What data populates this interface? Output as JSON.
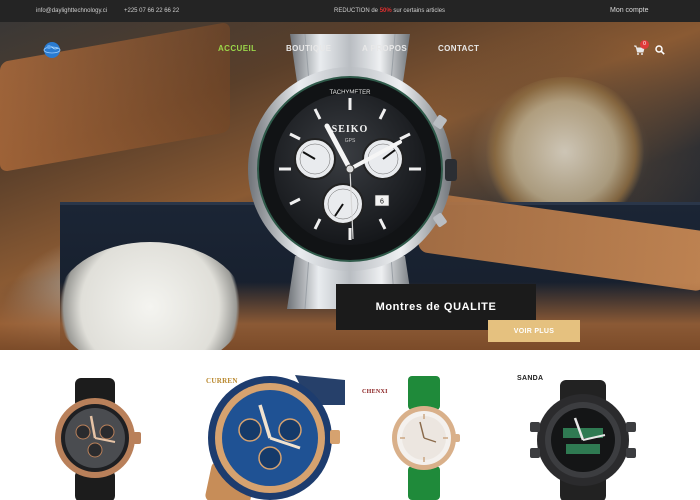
{
  "topbar": {
    "email": "info@daylighttechnology.ci",
    "phone": "+225 07 66 22 66 22",
    "promo_prefix": "REDUCTION de ",
    "promo_percent": "50%",
    "promo_suffix": " sur certains articles",
    "account_label": "Mon compte"
  },
  "nav": {
    "items": [
      "ACCUEIL",
      "BOUTIQUE",
      "A PROPOS",
      "CONTACT"
    ],
    "active_color": "#9bd64a"
  },
  "cart": {
    "count": "0",
    "icon": "shopping-cart-icon"
  },
  "search": {
    "icon": "search-icon"
  },
  "hero": {
    "title": "Montres de QUALITE",
    "cta_label": "VOIR PLUS",
    "cta_color": "#e5c17f",
    "watch_brand": "SEIKO",
    "watch_subdial_text": "GPS",
    "watch_bezel_text": "TACHYMETER"
  },
  "products": [
    {
      "brand": "",
      "icon": "rose-gold-chronograph-watch"
    },
    {
      "brand": "CURREN",
      "icon": "blue-curren-chronograph-watch"
    },
    {
      "brand": "CHENXI",
      "icon": "green-leather-ladies-watch"
    },
    {
      "brand": "SANDA",
      "icon": "black-digital-sport-watch"
    }
  ]
}
